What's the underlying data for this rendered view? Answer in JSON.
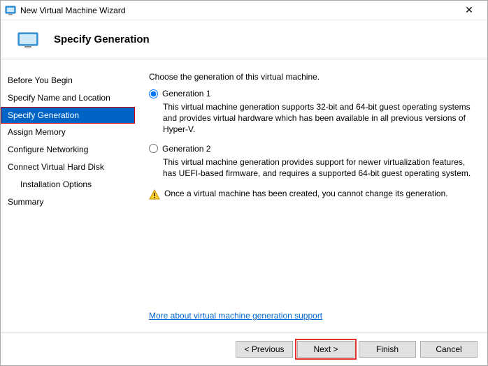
{
  "titlebar": {
    "title": "New Virtual Machine Wizard"
  },
  "header": {
    "title": "Specify Generation"
  },
  "sidebar": {
    "items": [
      {
        "label": "Before You Begin"
      },
      {
        "label": "Specify Name and Location"
      },
      {
        "label": "Specify Generation"
      },
      {
        "label": "Assign Memory"
      },
      {
        "label": "Configure Networking"
      },
      {
        "label": "Connect Virtual Hard Disk"
      },
      {
        "label": "Installation Options"
      },
      {
        "label": "Summary"
      }
    ],
    "selected_index": 2
  },
  "content": {
    "prompt": "Choose the generation of this virtual machine.",
    "options": [
      {
        "label": "Generation 1",
        "description": "This virtual machine generation supports 32-bit and 64-bit guest operating systems and provides virtual hardware which has been available in all previous versions of Hyper-V.",
        "checked": true
      },
      {
        "label": "Generation 2",
        "description": "This virtual machine generation provides support for newer virtualization features, has UEFI-based firmware, and requires a supported 64-bit guest operating system.",
        "checked": false
      }
    ],
    "warning": "Once a virtual machine has been created, you cannot change its generation.",
    "link": "More about virtual machine generation support"
  },
  "footer": {
    "previous": "< Previous",
    "next": "Next >",
    "finish": "Finish",
    "cancel": "Cancel"
  }
}
